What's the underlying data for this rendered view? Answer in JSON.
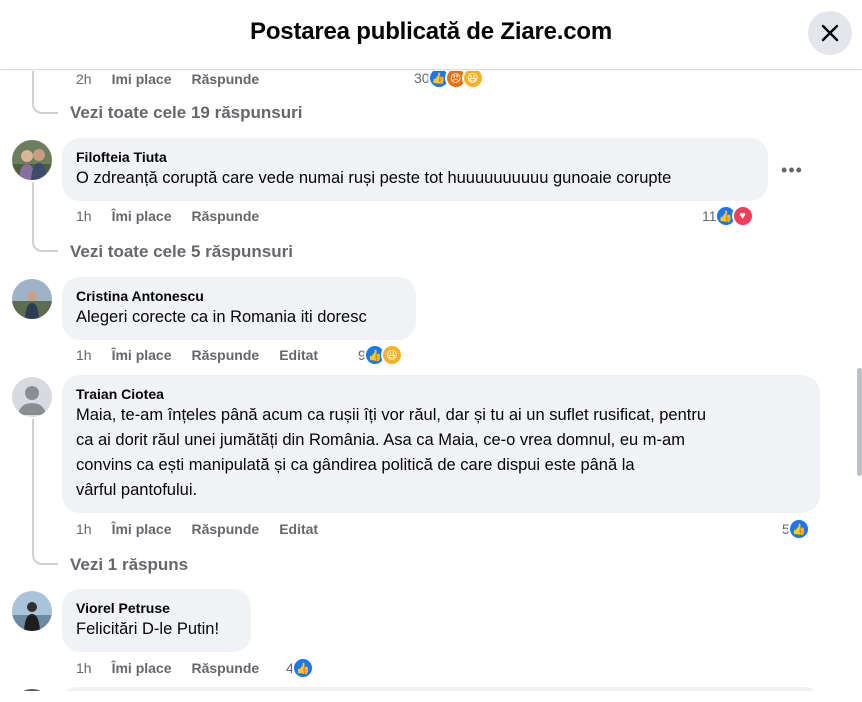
{
  "header": {
    "title": "Postarea publicată de Ziare.com"
  },
  "top_comment": {
    "time": "2h",
    "like_label": "Imi place",
    "reply_label": "Răspunde",
    "reaction_count": "30",
    "view_replies": "Vezi toate cele 19 răspunsuri"
  },
  "comments": [
    {
      "author": "Filofteia Tiuta",
      "text": "O zdreanță coruptă care vede numai ruși peste tot huuuuuuuuuu gunoaie corupte",
      "time": "1h",
      "like_label": "Îmi place",
      "reply_label": "Răspunde",
      "reaction_count": "11",
      "view_replies": "Vezi toate cele 5 răspunsuri"
    },
    {
      "author": "Cristina Antonescu",
      "text": "Alegeri corecte ca in Romania iti doresc",
      "time": "1h",
      "like_label": "Îmi place",
      "reply_label": "Răspunde",
      "edited_label": "Editat",
      "reaction_count": "9"
    },
    {
      "author": "Traian Ciotea",
      "text_lines": [
        "Maia, te-am înțeles până acum ca rușii îți vor răul, dar și tu ai un suflet rusificat, pentru",
        "ca ai dorit răul unei jumătăți din România. Asa ca Maia, ce-o vrea domnul, eu m-am",
        "convins ca ești manipulată și ca gândirea politică de care dispui este până la",
        "vârful pantofului."
      ],
      "time": "1h",
      "like_label": "Îmi place",
      "reply_label": "Răspunde",
      "edited_label": "Editat",
      "reaction_count": "5",
      "view_replies": "Vezi 1 răspuns"
    },
    {
      "author": "Viorel Petruse",
      "text": "Felicitări D-le Putin!",
      "time": "1h",
      "like_label": "Îmi place",
      "reply_label": "Răspunde",
      "reaction_count": "4"
    }
  ],
  "colors": {
    "like": "#1877f2",
    "love": "#f33e58",
    "haha": "#f7b125",
    "secondary_text": "#65676b",
    "bubble": "#f0f2f5"
  }
}
